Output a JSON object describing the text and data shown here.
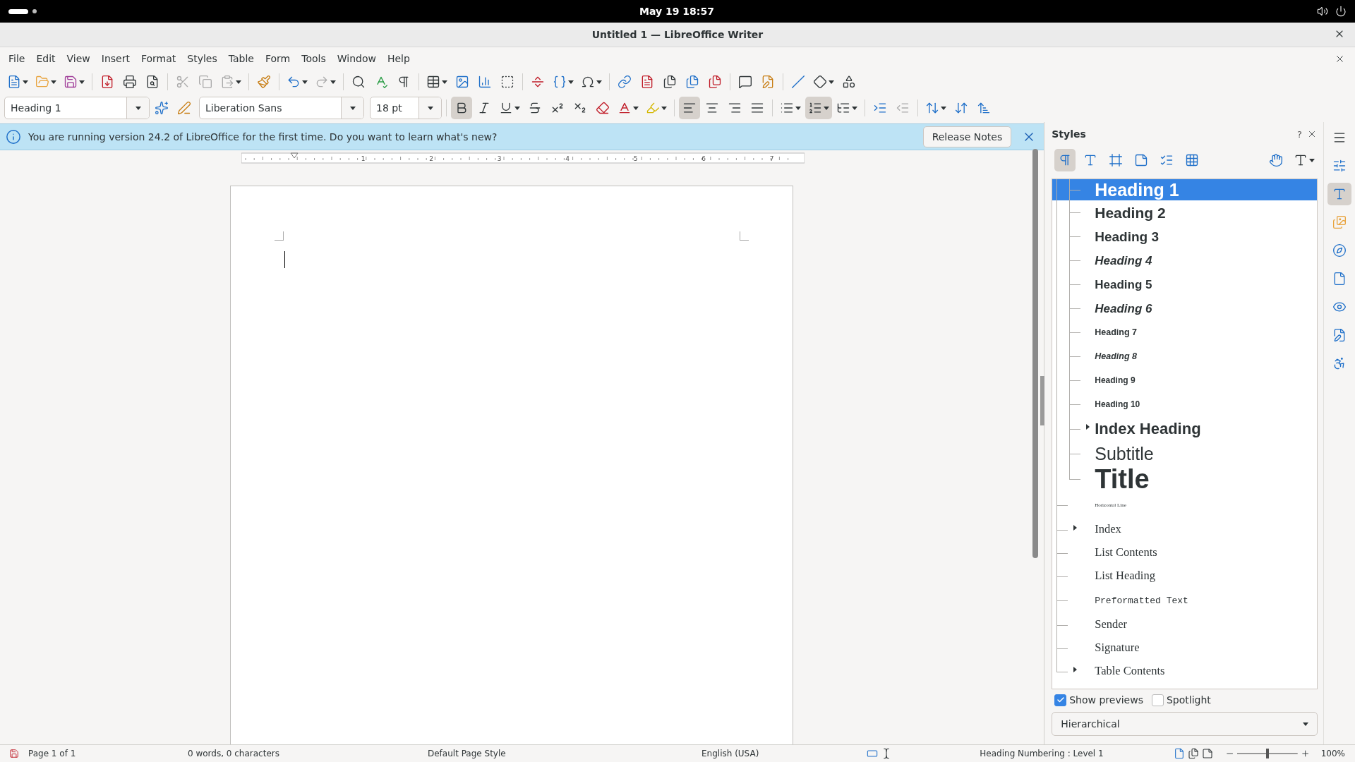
{
  "top_bar": {
    "clock": "May 19  18:57"
  },
  "window": {
    "title": "Untitled 1 — LibreOffice Writer"
  },
  "menu": [
    "File",
    "Edit",
    "View",
    "Insert",
    "Format",
    "Styles",
    "Table",
    "Form",
    "Tools",
    "Window",
    "Help"
  ],
  "formatting_bar": {
    "paragraph_style": "Heading 1",
    "font_name": "Liberation Sans",
    "font_size": "18 pt",
    "toggles": [
      {
        "kind": "bold",
        "on": true
      },
      {
        "kind": "italic",
        "on": false
      },
      {
        "kind": "underline",
        "on": false
      },
      {
        "kind": "strikethrough",
        "on": false
      },
      {
        "kind": "superscript",
        "on": false
      },
      {
        "kind": "subscript",
        "on": false
      }
    ],
    "alignment": [
      {
        "kind": "left",
        "selected": true
      },
      {
        "kind": "center",
        "selected": false
      },
      {
        "kind": "right",
        "selected": false
      },
      {
        "kind": "justify",
        "selected": false
      }
    ],
    "lists": [
      {
        "kind": "unordered",
        "on": false
      },
      {
        "kind": "ordered",
        "on": true
      },
      {
        "kind": "outline",
        "on": false
      }
    ]
  },
  "infobar": {
    "message": "You are running version 24.2 of LibreOffice for the first time. Do you want to learn what's new?",
    "button": "Release Notes"
  },
  "ruler": {
    "labels": [
      "1",
      "2",
      "3",
      "4",
      "5",
      "6",
      "7"
    ]
  },
  "sidebar": {
    "title": "Styles",
    "help": "?",
    "style_families": [
      {
        "kind": "paragraph",
        "selected": true
      },
      {
        "kind": "character",
        "selected": false
      },
      {
        "kind": "frame",
        "selected": false
      },
      {
        "kind": "page",
        "selected": false
      },
      {
        "kind": "list",
        "selected": false
      },
      {
        "kind": "table",
        "selected": false
      }
    ],
    "styles": [
      {
        "children": [
          {
            "label": "Heading 1",
            "kind": "heading-1",
            "selected": true
          },
          {
            "label": "Heading 2",
            "kind": "heading-2",
            "selected": false
          },
          {
            "label": "Heading 3",
            "kind": "heading-3",
            "selected": false
          },
          {
            "label": "Heading 4",
            "kind": "heading-4",
            "selected": false
          },
          {
            "label": "Heading 5",
            "kind": "heading-5",
            "selected": false
          },
          {
            "label": "Heading 6",
            "kind": "heading-6",
            "selected": false
          },
          {
            "label": "Heading 7",
            "kind": "heading-7",
            "selected": false
          },
          {
            "label": "Heading 8",
            "kind": "heading-8",
            "selected": false
          },
          {
            "label": "Heading 9",
            "kind": "heading-9",
            "selected": false
          },
          {
            "label": "Heading 10",
            "kind": "heading-10",
            "selected": false
          },
          {
            "label": "Index Heading",
            "kind": "index-heading",
            "selected": false,
            "expanded": false
          },
          {
            "label": "Subtitle",
            "kind": "subtitle",
            "selected": false
          },
          {
            "label": "Title",
            "kind": "title",
            "selected": false
          }
        ]
      },
      {
        "label": "Horizontal Line",
        "kind": "horizontal-line",
        "selected": false
      },
      {
        "label": "Index",
        "kind": "serif",
        "selected": false,
        "expanded": false
      },
      {
        "label": "List Contents",
        "kind": "serif",
        "selected": false
      },
      {
        "label": "List Heading",
        "kind": "serif",
        "selected": false
      },
      {
        "label": "Preformatted Text",
        "kind": "mono",
        "selected": false
      },
      {
        "label": "Sender",
        "kind": "serif",
        "selected": false
      },
      {
        "label": "Signature",
        "kind": "serif",
        "selected": false
      },
      {
        "label": "Table Contents",
        "kind": "serif",
        "selected": false,
        "expanded": false
      }
    ],
    "show_previews": {
      "label": "Show previews",
      "checked": true
    },
    "spotlight": {
      "label": "Spotlight",
      "checked": false
    },
    "filter": "Hierarchical",
    "deck_tabs": [
      {
        "kind": "properties",
        "selected": false
      },
      {
        "kind": "styles",
        "selected": true
      },
      {
        "kind": "gallery",
        "selected": false
      },
      {
        "kind": "navigator",
        "selected": false
      },
      {
        "kind": "page",
        "selected": false
      },
      {
        "kind": "style-inspector",
        "selected": false
      },
      {
        "kind": "manage-changes",
        "selected": false
      },
      {
        "kind": "accessibility",
        "selected": false
      }
    ]
  },
  "status_bar": {
    "page": "Page 1 of 1",
    "words": "0 words, 0 characters",
    "page_style": "Default Page Style",
    "language": "English (USA)",
    "outline": "Heading Numbering : Level 1",
    "zoom": "100%",
    "zoom_slider": {
      "level": 0.5
    }
  }
}
